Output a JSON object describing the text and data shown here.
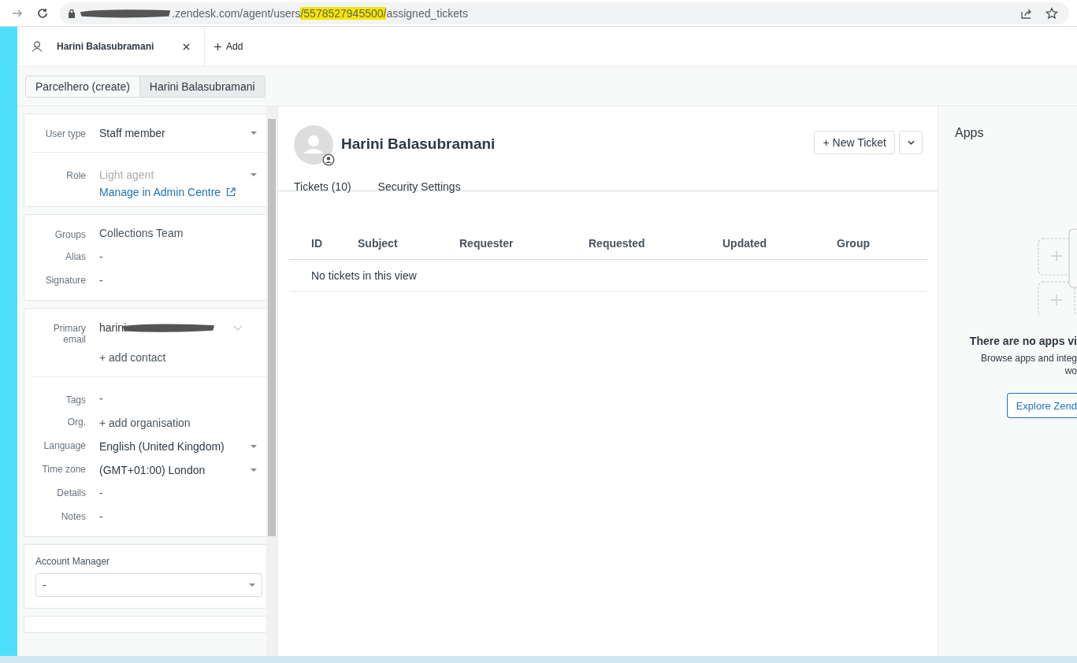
{
  "browser": {
    "url_prefix": ".zendesk.com/agent/users",
    "url_highlight": "/5578527945500/",
    "url_suffix": "assigned_tickets"
  },
  "tabs": [
    {
      "label": "Harini Balasubramani"
    }
  ],
  "add_tab": {
    "label": "Add"
  },
  "breadcrumbs": [
    {
      "label": "Parcelhero (create)",
      "selected": false
    },
    {
      "label": "Harini Balasubramani",
      "selected": true
    }
  ],
  "user_cards": [
    {
      "sections": [
        [
          {
            "kind": "select",
            "label": "User type",
            "value": "Staff member",
            "disabled": false
          }
        ],
        [
          {
            "kind": "select",
            "label": "Role",
            "value": "Light agent",
            "disabled": true,
            "link": "Manage in Admin Centre"
          }
        ]
      ]
    },
    {
      "sections": [
        [
          {
            "kind": "text",
            "label": "Groups",
            "value": "Collections Team"
          },
          {
            "kind": "text",
            "label": "Alias",
            "value": "-"
          },
          {
            "kind": "text",
            "label": "Signature",
            "value": "-"
          }
        ]
      ]
    },
    {
      "sections": [
        [
          {
            "kind": "email",
            "label": "Primary email",
            "value": "harini"
          },
          {
            "kind": "action",
            "value": "+ add contact"
          }
        ],
        [
          {
            "kind": "text",
            "label": "Tags",
            "value": "-"
          },
          {
            "kind": "action",
            "label": "Org.",
            "value": "+ add organisation"
          },
          {
            "kind": "select",
            "label": "Language",
            "value": "English (United Kingdom)",
            "disabled": false
          },
          {
            "kind": "select",
            "label": "Time zone",
            "value": "(GMT+01:00) London",
            "disabled": false
          },
          {
            "kind": "text",
            "label": "Details",
            "value": "-"
          },
          {
            "kind": "text",
            "label": "Notes",
            "value": "-"
          }
        ]
      ]
    }
  ],
  "account_manager": {
    "label": "Account Manager",
    "value": "-"
  },
  "profile": {
    "name": "Harini Balasubramani",
    "new_ticket": "+ New Ticket"
  },
  "profile_tabs": [
    {
      "label": "Tickets (10)"
    },
    {
      "label": "Security Settings"
    }
  ],
  "table": {
    "columns": [
      "ID",
      "Subject",
      "Requester",
      "Requested",
      "Updated",
      "Group"
    ],
    "empty_message": "No tickets in this view"
  },
  "apps": {
    "title": "Apps",
    "empty_title": "There are no apps vi",
    "description_lines": [
      "Browse apps and integ",
      "wo"
    ],
    "button": "Explore Zend"
  }
}
